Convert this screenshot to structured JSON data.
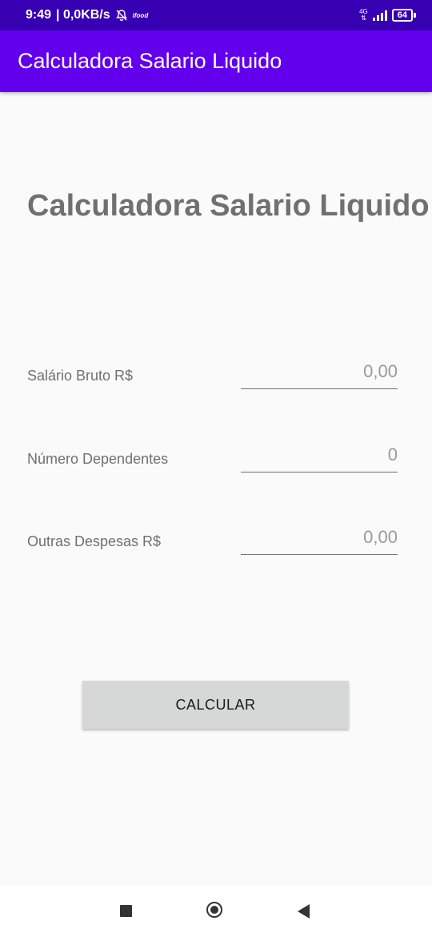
{
  "status_bar": {
    "time": "9:49",
    "network_speed": "| 0,0KB/s",
    "mini_icon_text": "ifood",
    "network_type": "4G",
    "battery_level": "64"
  },
  "app_bar": {
    "title": "Calculadora Salario Liquido"
  },
  "main": {
    "heading": "Calculadora Salario Liquido",
    "fields": [
      {
        "label": "Salário Bruto R$",
        "placeholder": "0,00"
      },
      {
        "label": "Número Dependentes",
        "placeholder": "0"
      },
      {
        "label": "Outras Despesas R$",
        "placeholder": "0,00"
      }
    ],
    "button_label": "CALCULAR"
  },
  "nav_bar": {
    "recents_icon": "square-icon",
    "home_icon": "circle-icon",
    "back_icon": "triangle-back-icon"
  },
  "colors": {
    "status_bar": "#3700b3",
    "app_bar": "#6200ee",
    "button": "#d6d7d7",
    "text_gray": "#707070"
  }
}
